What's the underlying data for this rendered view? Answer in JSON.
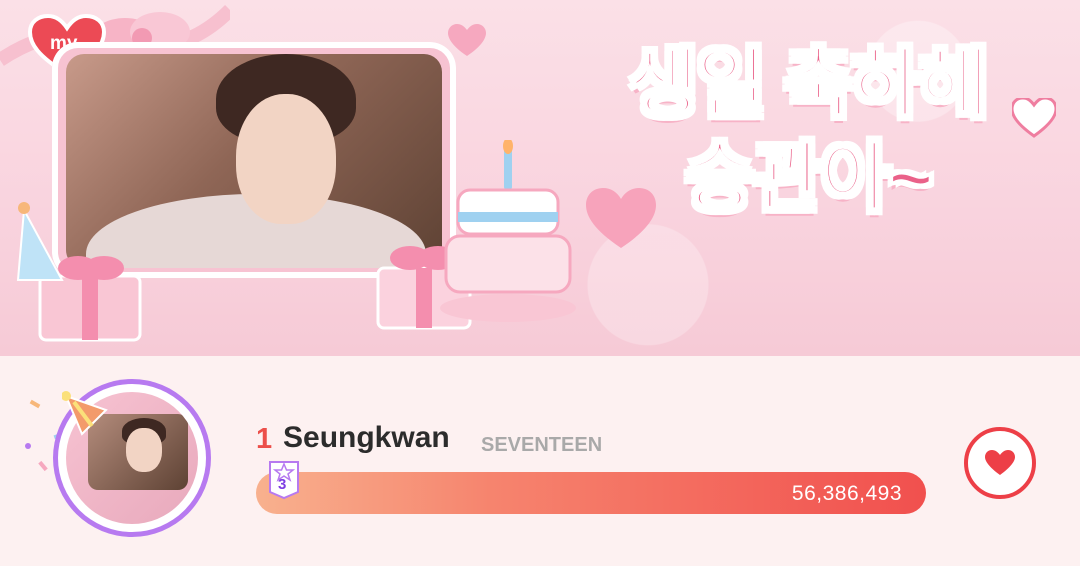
{
  "banner": {
    "badge_label": "my",
    "title": "생일 축하해\n승관아~"
  },
  "entry": {
    "rank": "1",
    "name": "Seungkwan",
    "group": "SEVENTEEN",
    "tier": "3",
    "votes": "56,386,493",
    "progress_fraction": 1.0
  },
  "colors": {
    "accent_red": "#ed3f47",
    "title_pink": "#ea6189",
    "ring_purple": "#b77af0"
  },
  "icons": {
    "heart_button": "heart-icon",
    "tier_badge": "tier-badge-icon",
    "badge": "heart-badge-icon"
  }
}
